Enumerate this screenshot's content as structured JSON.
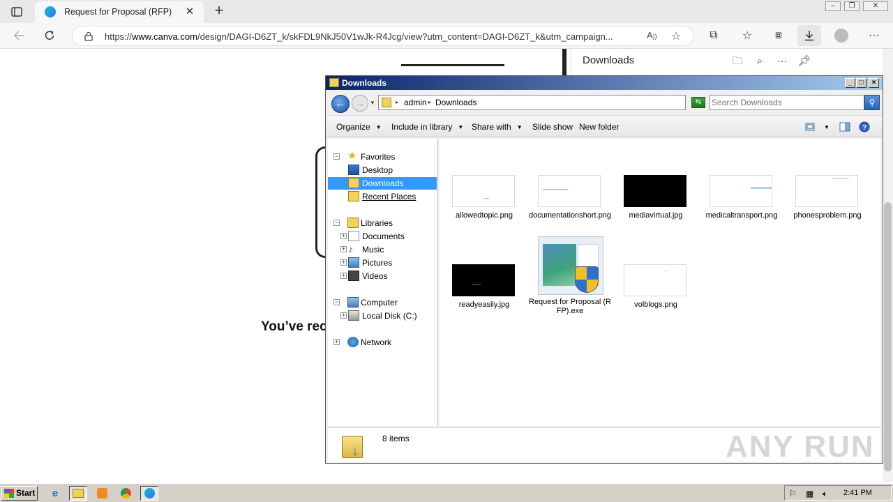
{
  "browser": {
    "tab_title": "Request for Proposal (RFP)",
    "url_prefix": "https://",
    "url_host": "www.canva.com",
    "url_rest": "/design/DAGI-D6ZT_k/skFDL9NkJ50V1wJk-R4Jcg/view?utm_content=DAGI-D6ZT_k&utm_campaign...",
    "new_tab_glyph": "+",
    "close_glyph": "✕"
  },
  "page": {
    "partial_text": "You’ve rec"
  },
  "downloads_flyout": {
    "title": "Downloads"
  },
  "explorer": {
    "title": "Downloads",
    "breadcrumb": [
      "admin",
      "Downloads"
    ],
    "search_placeholder": "Search Downloads",
    "commands": {
      "organize": "Organize",
      "include_in_library": "Include in library",
      "share_with": "Share with",
      "slide_show": "Slide show",
      "new_folder": "New folder"
    },
    "nav": {
      "favorites": "Favorites",
      "desktop": "Desktop",
      "downloads": "Downloads",
      "recent_places": "Recent Places",
      "libraries": "Libraries",
      "documents": "Documents",
      "music": "Music",
      "pictures": "Pictures",
      "videos": "Videos",
      "computer": "Computer",
      "local_disk": "Local Disk (C:)",
      "network": "Network"
    },
    "files": [
      {
        "name": "allowedtopic.png",
        "thumb": "light"
      },
      {
        "name": "documentationshort.png",
        "thumb": "light"
      },
      {
        "name": "mediavirtual.jpg",
        "thumb": "dark"
      },
      {
        "name": "medicaltransport.png",
        "thumb": "light"
      },
      {
        "name": "phonesproblem.png",
        "thumb": "light"
      },
      {
        "name": "readyeasily.jpg",
        "thumb": "dark"
      },
      {
        "name": "Request for Proposal (RFP).exe",
        "thumb": "exe"
      },
      {
        "name": "volblogs.png",
        "thumb": "light"
      }
    ],
    "status": "8 items"
  },
  "watermark": "ANY RUN",
  "taskbar": {
    "start": "Start",
    "clock": "2:41 PM"
  },
  "colors": {
    "selection": "#3399ff",
    "titlebar_start": "#0a246a",
    "titlebar_end": "#a6caf0",
    "edge_chrome": "#f7f7f7"
  }
}
